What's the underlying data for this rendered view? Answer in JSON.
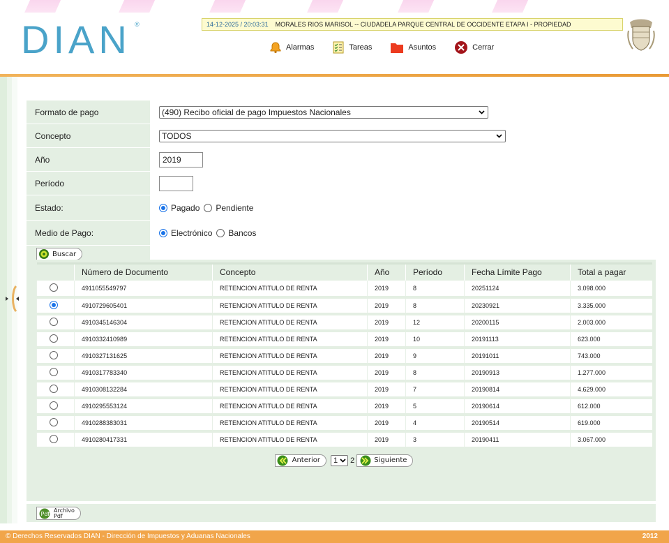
{
  "header": {
    "logo_text": "DIAN",
    "logo_mark": "®",
    "session": {
      "timestamp": "14-12-2025 / 20:03:31",
      "user_info": "MORALES RIOS MARISOL -- CIUDADELA PARQUE CENTRAL DE OCCIDENTE ETAPA I - PROPIEDAD"
    },
    "menu": [
      {
        "label": "Alarmas",
        "icon": "bell-icon"
      },
      {
        "label": "Tareas",
        "icon": "checklist-icon"
      },
      {
        "label": "Asuntos",
        "icon": "folder-icon"
      },
      {
        "label": "Cerrar",
        "icon": "close-circle-icon"
      }
    ],
    "seal_icon": "colombia-coat-of-arms-icon"
  },
  "form": {
    "formato_pago": {
      "label": "Formato de pago",
      "value": "(490) Recibo oficial de pago Impuestos Nacionales"
    },
    "concepto": {
      "label": "Concepto",
      "value": "TODOS"
    },
    "anio": {
      "label": "Año",
      "value": "2019"
    },
    "periodo": {
      "label": "Período",
      "value": ""
    },
    "estado": {
      "label": "Estado:",
      "options": [
        "Pagado",
        "Pendiente"
      ],
      "selected": "Pagado"
    },
    "medio_pago": {
      "label": "Medio de Pago:",
      "options": [
        "Electrónico",
        "Bancos"
      ],
      "selected": "Electrónico"
    },
    "buscar_label": "Buscar"
  },
  "table": {
    "columns": [
      "",
      "Número de Documento",
      "Concepto",
      "Año",
      "Período",
      "Fecha Límite Pago",
      "Total a pagar"
    ],
    "rows": [
      {
        "selected": false,
        "doc": "4911055549797",
        "concepto": "RETENCION ATITULO DE RENTA",
        "anio": "2019",
        "periodo": "8",
        "fecha": "20251124",
        "total": "3.098.000"
      },
      {
        "selected": true,
        "doc": "4910729605401",
        "concepto": "RETENCION ATITULO DE RENTA",
        "anio": "2019",
        "periodo": "8",
        "fecha": "20230921",
        "total": "3.335.000"
      },
      {
        "selected": false,
        "doc": "4910345146304",
        "concepto": "RETENCION ATITULO DE RENTA",
        "anio": "2019",
        "periodo": "12",
        "fecha": "20200115",
        "total": "2.003.000"
      },
      {
        "selected": false,
        "doc": "4910332410989",
        "concepto": "RETENCION ATITULO DE RENTA",
        "anio": "2019",
        "periodo": "10",
        "fecha": "20191113",
        "total": "623.000"
      },
      {
        "selected": false,
        "doc": "4910327131625",
        "concepto": "RETENCION ATITULO DE RENTA",
        "anio": "2019",
        "periodo": "9",
        "fecha": "20191011",
        "total": "743.000"
      },
      {
        "selected": false,
        "doc": "4910317783340",
        "concepto": "RETENCION ATITULO DE RENTA",
        "anio": "2019",
        "periodo": "8",
        "fecha": "20190913",
        "total": "1.277.000"
      },
      {
        "selected": false,
        "doc": "4910308132284",
        "concepto": "RETENCION ATITULO DE RENTA",
        "anio": "2019",
        "periodo": "7",
        "fecha": "20190814",
        "total": "4.629.000"
      },
      {
        "selected": false,
        "doc": "4910295553124",
        "concepto": "RETENCION ATITULO DE RENTA",
        "anio": "2019",
        "periodo": "5",
        "fecha": "20190614",
        "total": "612.000"
      },
      {
        "selected": false,
        "doc": "4910288383031",
        "concepto": "RETENCION ATITULO DE RENTA",
        "anio": "2019",
        "periodo": "4",
        "fecha": "20190514",
        "total": "619.000"
      },
      {
        "selected": false,
        "doc": "4910280417331",
        "concepto": "RETENCION ATITULO DE RENTA",
        "anio": "2019",
        "periodo": "3",
        "fecha": "20190411",
        "total": "3.067.000"
      }
    ]
  },
  "pager": {
    "prev_label": "Anterior",
    "current_page": "1",
    "next_page": "2",
    "next_label": "Siguiente"
  },
  "pdf_button": {
    "line1": "Archivo",
    "line2": "Pdf"
  },
  "footer": {
    "copyright": "© Derechos Reservados DIAN - Dirección de Impuestos y Aduanas Nacionales",
    "year": "2012"
  },
  "colors": {
    "panel": "#e4efe3",
    "accent_orange": "#f1a54a",
    "logo_blue": "#4aa3c9",
    "radio_blue": "#1a73e8"
  }
}
